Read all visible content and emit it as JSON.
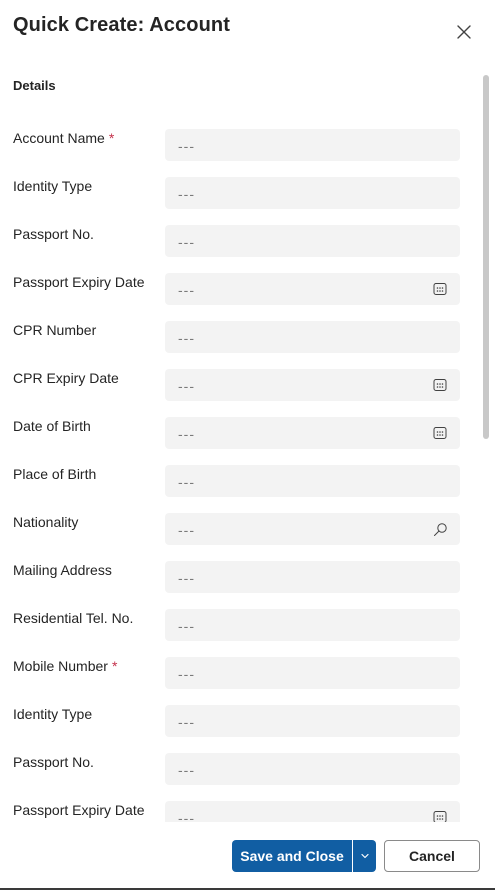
{
  "dialog": {
    "title": "Quick Create: Account",
    "close_icon": "close-icon"
  },
  "section": {
    "title": "Details"
  },
  "fields": [
    {
      "label": "Account Name",
      "required": true,
      "value": "---",
      "icon": ""
    },
    {
      "label": "Identity Type",
      "required": false,
      "value": "---",
      "icon": ""
    },
    {
      "label": "Passport No.",
      "required": false,
      "value": "---",
      "icon": ""
    },
    {
      "label": "Passport Expiry Date",
      "required": false,
      "value": "---",
      "icon": "calendar-icon"
    },
    {
      "label": "CPR Number",
      "required": false,
      "value": "---",
      "icon": ""
    },
    {
      "label": "CPR Expiry Date",
      "required": false,
      "value": "---",
      "icon": "calendar-icon"
    },
    {
      "label": "Date of Birth",
      "required": false,
      "value": "---",
      "icon": "calendar-icon"
    },
    {
      "label": "Place of Birth",
      "required": false,
      "value": "---",
      "icon": ""
    },
    {
      "label": "Nationality",
      "required": false,
      "value": "---",
      "icon": "search-icon"
    },
    {
      "label": "Mailing Address",
      "required": false,
      "value": "---",
      "icon": ""
    },
    {
      "label": "Residential Tel. No.",
      "required": false,
      "value": "---",
      "icon": ""
    },
    {
      "label": "Mobile Number",
      "required": true,
      "value": "---",
      "icon": ""
    },
    {
      "label": "Identity Type",
      "required": false,
      "value": "---",
      "icon": ""
    },
    {
      "label": "Passport No.",
      "required": false,
      "value": "---",
      "icon": ""
    },
    {
      "label": "Passport Expiry Date",
      "required": false,
      "value": "---",
      "icon": "calendar-icon"
    }
  ],
  "required_marker": "*",
  "footer": {
    "save_label": "Save and Close",
    "split_icon": "chevron-down-icon",
    "cancel_label": "Cancel"
  },
  "colors": {
    "primary": "#115ea3",
    "required": "#c4314b",
    "input_bg": "#f3f3f3",
    "placeholder": "#7a7a7a"
  }
}
